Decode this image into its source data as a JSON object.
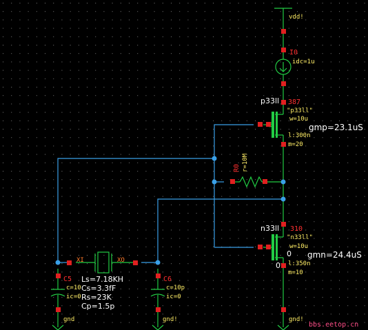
{
  "colors": {
    "background": "#000000",
    "grid": "#7a7a7a",
    "wire_green": "#22cc44",
    "wire_blue": "#3aa0e8",
    "pin_red": "#e02020",
    "label_red": "#ff3030",
    "label_yellow": "#ffee66",
    "param_white": "#ffffff",
    "watermark": "#ff4d88"
  },
  "labels": {
    "vdd": "vdd!",
    "gnd1": "gnd",
    "gnd2": "gnd!",
    "gnd3": "gnd!",
    "i_name": "I0",
    "i_idc": "idc=1u",
    "p_model_top": "p33ll",
    "p_inst": "387",
    "p_model": "\"p33ll\"",
    "p_w": "w=10u",
    "p_l": "l:300n",
    "p_m": "m=20",
    "gmp": "gmp=23.1uS",
    "r_name": "R0",
    "r_val": "r=10M",
    "n_model_top": "n33ll",
    "n_inst": "310",
    "n_model": "\"n33ll\"",
    "n_w": "w=10u",
    "n_l": "l:350n",
    "n_m": "m=10",
    "n_zero_a": "0",
    "n_zero_b": "0",
    "gmn": "gmn=24.4uS",
    "x1": "XI",
    "xo": "XO",
    "c5_name": "C5",
    "c5_c": "c=10",
    "c5_ic": "ic=0",
    "c6_name": "C6",
    "c6_c": "c=10p",
    "c6_ic": "ic=0",
    "ls": "Ls=7.18KH",
    "cs": "Cs=3.3fF",
    "rs": "Rs=23K",
    "cp": "Cp=1.5p",
    "watermark": "bbs.eetop.cn"
  }
}
